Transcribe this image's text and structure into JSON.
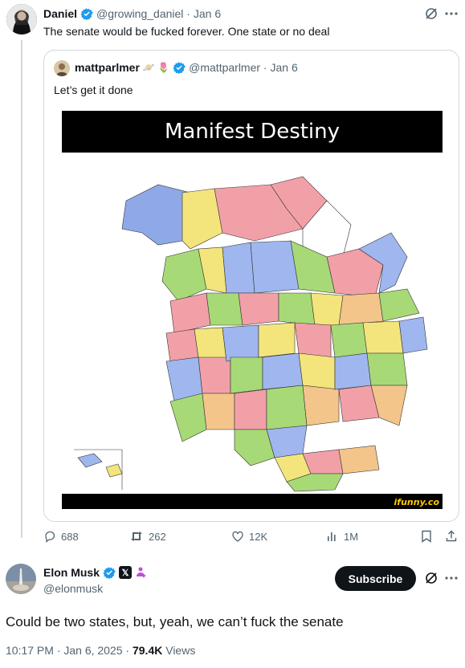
{
  "reply": {
    "name": "Daniel",
    "handle": "@growing_daniel",
    "time": "Jan 6",
    "text": "The senate would be fucked forever. One state or no deal"
  },
  "quoted": {
    "name": "mattparlmer",
    "emoji": "🪐 🌷",
    "handle": "@mattparlmer",
    "time": "Jan 6",
    "text": "Let’s get it done",
    "image_title": "Manifest Destiny",
    "watermark": "ifunny.co"
  },
  "actions": {
    "replies": "688",
    "reposts": "262",
    "likes": "12K",
    "views": "1M"
  },
  "main": {
    "name": "Elon Musk",
    "handle": "@elonmusk",
    "subscribe_label": "Subscribe",
    "text": "Could be two states, but, yeah, we can’t fuck the senate",
    "timestamp": "10:17 PM · Jan 6, 2025 ·",
    "views": "79.4K",
    "views_label": "Views"
  },
  "colors": {
    "verified_blue": "#1d9bf0",
    "muted": "#536471",
    "border": "#cfd9de"
  }
}
